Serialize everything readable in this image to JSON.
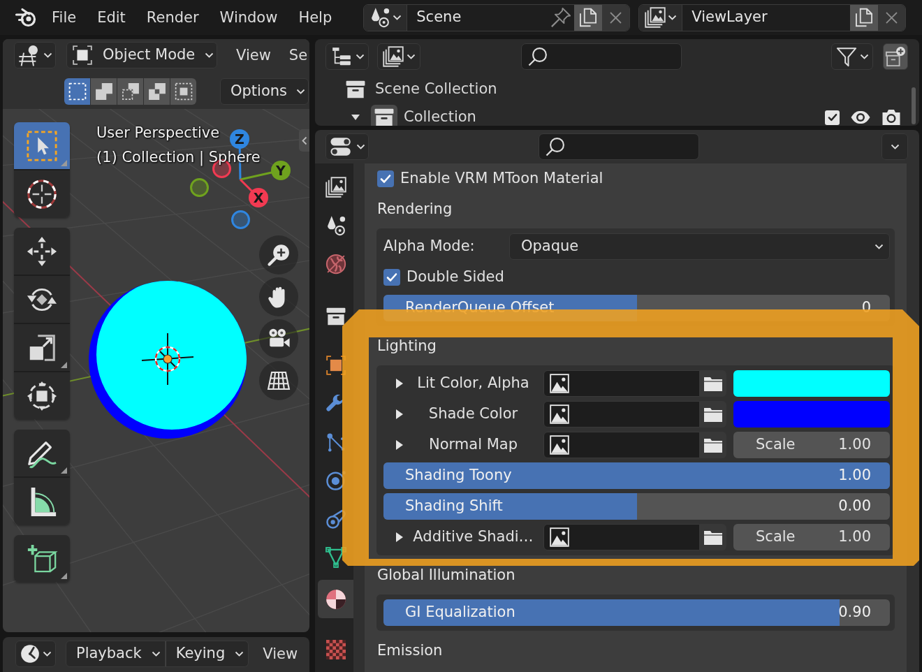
{
  "topbar": {
    "menus": [
      "File",
      "Edit",
      "Render",
      "Window",
      "Help"
    ],
    "scene": "Scene",
    "view_layer": "ViewLayer"
  },
  "viewport": {
    "mode": "Object Mode",
    "editor_menus": [
      "View",
      "Se"
    ],
    "select_modes": [
      {
        "kind": "set",
        "selected": true
      },
      {
        "kind": "extend",
        "selected": false
      },
      {
        "kind": "subtract",
        "selected": false
      },
      {
        "kind": "invert",
        "selected": false
      },
      {
        "kind": "intersect",
        "selected": false
      }
    ],
    "options": "Options",
    "view_name": "User Perspective",
    "object_info": "(1) Collection | Sphere",
    "gizmo_axes": [
      {
        "label": "Z",
        "color": "#2f86e0"
      },
      {
        "label": "Y",
        "color": "#6fa21e"
      },
      {
        "label": "X",
        "color": "#f23a52"
      }
    ],
    "tool_groups": [
      {
        "tools": [
          {
            "kind": "select_box",
            "selected": true,
            "submenu": true
          },
          {
            "kind": "cursor",
            "selected": false,
            "submenu": false
          }
        ]
      },
      {
        "tools": [
          {
            "kind": "move",
            "selected": false,
            "submenu": false
          },
          {
            "kind": "rotate",
            "selected": false,
            "submenu": false
          },
          {
            "kind": "scale",
            "selected": false,
            "submenu": true
          },
          {
            "kind": "transform",
            "selected": false,
            "submenu": false
          }
        ]
      },
      {
        "tools": [
          {
            "kind": "annotate",
            "selected": false,
            "submenu": true
          },
          {
            "kind": "measure",
            "selected": false,
            "submenu": false
          }
        ]
      },
      {
        "tools": [
          {
            "kind": "add_cube",
            "selected": false,
            "submenu": true
          }
        ]
      }
    ],
    "nav_buttons": [
      {
        "kind": "zoom"
      },
      {
        "kind": "pan"
      },
      {
        "kind": "camera"
      },
      {
        "kind": "perspective"
      }
    ]
  },
  "timeline": {
    "menus": [
      {
        "label": "Playback",
        "dropdown": true
      },
      {
        "label": "Keying",
        "dropdown": true
      },
      {
        "label": "View",
        "dropdown": false
      }
    ]
  },
  "outliner": {
    "rows": [
      {
        "kind": "scene_collection",
        "label": "Scene Collection"
      },
      {
        "kind": "collection",
        "label": "Collection",
        "expanded": true,
        "checked": true
      }
    ]
  },
  "properties": {
    "tab_groups": [
      {
        "tabs": [
          {
            "kind": "output",
            "selected": false
          },
          {
            "kind": "scene",
            "selected": false
          },
          {
            "kind": "world",
            "selected": false
          }
        ]
      },
      {
        "tabs": [
          {
            "kind": "collection",
            "selected": false
          }
        ]
      },
      {
        "tabs": [
          {
            "kind": "object",
            "selected": false
          },
          {
            "kind": "modifiers",
            "selected": false
          },
          {
            "kind": "particles",
            "selected": false
          },
          {
            "kind": "physics",
            "selected": false
          },
          {
            "kind": "constraints",
            "selected": false
          },
          {
            "kind": "data",
            "selected": false
          }
        ]
      },
      {
        "tabs": [
          {
            "kind": "material",
            "selected": true
          }
        ]
      },
      {
        "tabs": [
          {
            "kind": "texture",
            "selected": false
          }
        ]
      }
    ],
    "enable": {
      "label": "Enable VRM MToon Material",
      "checked": true
    },
    "sections": [
      {
        "label": "Rendering",
        "highlighted": false,
        "items": [
          {
            "kind": "dropdown",
            "label": "Alpha Mode:",
            "value": "Opaque"
          },
          {
            "kind": "checkbox",
            "label": "Double Sided",
            "checked": true
          },
          {
            "kind": "slider",
            "label": "RenderQueue Offset",
            "value": "0",
            "level": 0.5
          }
        ]
      },
      {
        "label": "Lighting",
        "highlighted": true,
        "items": [
          {
            "kind": "texture",
            "label": "Lit Color, Alpha",
            "expanded": false,
            "color": "#00ffff"
          },
          {
            "kind": "texture",
            "label": "Shade Color",
            "expanded": false,
            "color": "#0000ff"
          },
          {
            "kind": "texture",
            "label": "Normal Map",
            "expanded": false,
            "scale_label": "Scale",
            "scale_value": "1.00"
          },
          {
            "kind": "slider",
            "label": "Shading Toony",
            "value": "1.00",
            "level": 1
          },
          {
            "kind": "slider",
            "label": "Shading Shift",
            "value": "0.00",
            "level": 0.5
          },
          {
            "kind": "texture",
            "label": "Additive Shadi…",
            "expanded": false,
            "scale_label": "Scale",
            "scale_value": "1.00"
          }
        ]
      },
      {
        "label": "Global Illumination",
        "highlighted": false,
        "items": [
          {
            "kind": "slider",
            "label": "GI Equalization",
            "value": "0.90",
            "level": 0.9
          }
        ]
      },
      {
        "label": "Emission",
        "highlighted": false
      }
    ]
  }
}
